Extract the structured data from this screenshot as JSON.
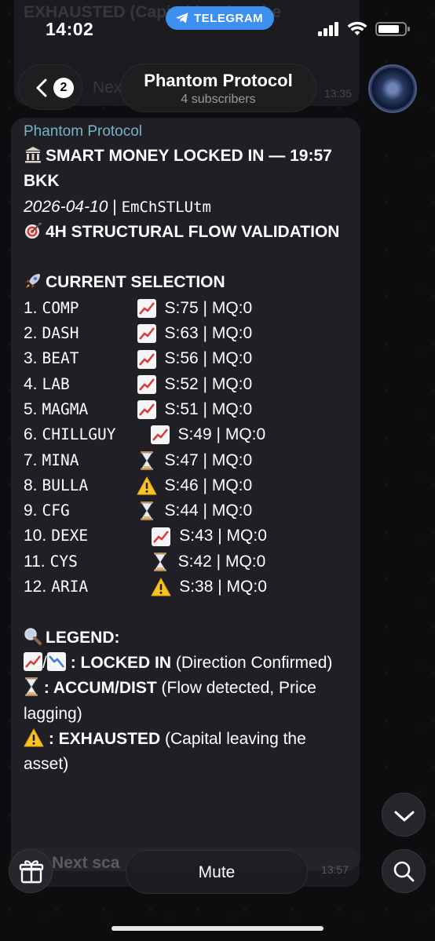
{
  "status_bar": {
    "time": "14:02",
    "pill_label": "TELEGRAM"
  },
  "header": {
    "unread_count": "2",
    "channel_title": "Phantom Protocol",
    "subscribers": "4 subscribers"
  },
  "ghost_top": {
    "text": "EXHAUSTED (Capital leaving the",
    "text2": "Next sc",
    "time": "13:35"
  },
  "message": {
    "sender": "Phantom Protocol",
    "headline": "SMART MONEY LOCKED IN — 19:57 BKK",
    "date": "2026-04-10",
    "code": "EmChSTLUtm",
    "subtitle": "4H STRUCTURAL FLOW VALIDATION",
    "section_title": "CURRENT SELECTION",
    "rows": [
      {
        "index": "1.",
        "ticker": "COMP",
        "icon": "chart-up",
        "stats": "S:75 | MQ:0"
      },
      {
        "index": "2.",
        "ticker": "DASH",
        "icon": "chart-up",
        "stats": "S:63 | MQ:0"
      },
      {
        "index": "3.",
        "ticker": "BEAT",
        "icon": "chart-up",
        "stats": "S:56 | MQ:0"
      },
      {
        "index": "4.",
        "ticker": "LAB",
        "icon": "chart-up",
        "stats": "S:52 | MQ:0"
      },
      {
        "index": "5.",
        "ticker": "MAGMA",
        "icon": "chart-up",
        "stats": "S:51 | MQ:0"
      },
      {
        "index": "6.",
        "ticker": "CHILLGUY",
        "icon": "chart-up",
        "stats": "S:49 | MQ:0"
      },
      {
        "index": "7.",
        "ticker": "MINA",
        "icon": "hourglass",
        "stats": "S:47 | MQ:0"
      },
      {
        "index": "8.",
        "ticker": "BULLA",
        "icon": "warning",
        "stats": "S:46 | MQ:0"
      },
      {
        "index": "9.",
        "ticker": "CFG",
        "icon": "hourglass",
        "stats": "S:44 | MQ:0"
      },
      {
        "index": "10.",
        "ticker": "DEXE",
        "icon": "chart-up",
        "stats": "S:43 | MQ:0"
      },
      {
        "index": "11.",
        "ticker": "CYS",
        "icon": "hourglass",
        "stats": "S:42 | MQ:0"
      },
      {
        "index": "12.",
        "ticker": "ARIA",
        "icon": "warning",
        "stats": "S:38 | MQ:0"
      }
    ],
    "legend_title": "LEGEND:",
    "legend": [
      {
        "icon": "chart-up-down",
        "sep": "/",
        "key": ": LOCKED IN",
        "desc": " (Direction Confirmed)"
      },
      {
        "icon": "hourglass",
        "key": " : ACCUM/DIST",
        "desc": " (Flow detected, Price lagging)"
      },
      {
        "icon": "warning",
        "key": " : EXHAUSTED",
        "desc": " (Capital leaving the asset)"
      }
    ]
  },
  "ghost_bottom": {
    "text": "Next sca",
    "time": "13:57"
  },
  "bottom_bar": {
    "mute_label": "Mute"
  },
  "colors": {
    "accent": "#3d8ff0",
    "sender": "#74b4c8",
    "bubble": "#212026"
  }
}
